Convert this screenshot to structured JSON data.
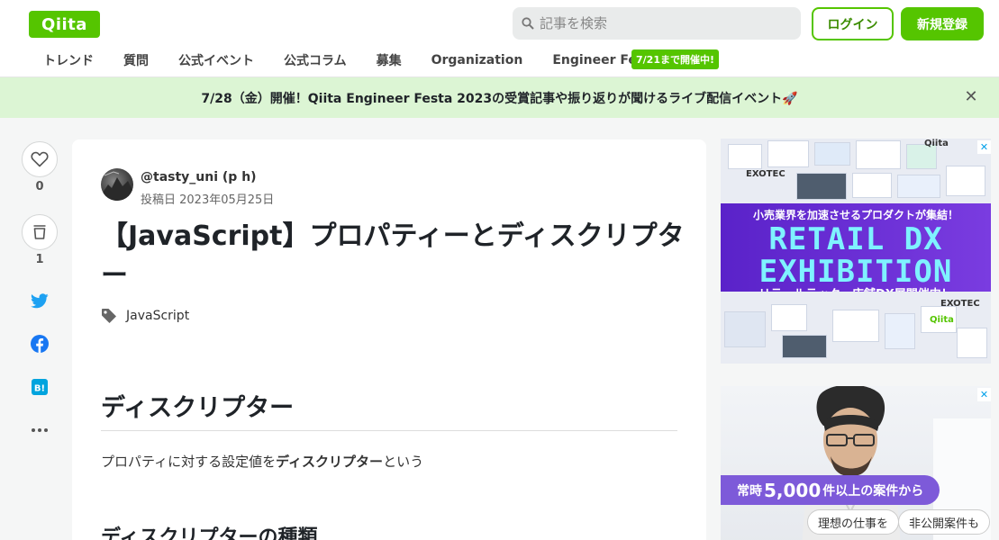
{
  "header": {
    "logo": "Qiita",
    "search_placeholder": "記事を検索",
    "login_label": "ログイン",
    "register_label": "新規登録",
    "nav": [
      "トレンド",
      "質問",
      "公式イベント",
      "公式コラム",
      "募集",
      "Organization",
      "Engineer Festa"
    ],
    "nav_badge": "7/21まで開催中!"
  },
  "banner": {
    "text": "7/28（金）開催！Qiita Engineer Festa 2023の受賞記事や振り返りが聞けるライブ配信イベント🚀",
    "close": "✕"
  },
  "actions": {
    "like_count": "0",
    "stock_count": "1"
  },
  "article": {
    "author": "@tasty_uni (p h)",
    "posted": "投稿日 2023年05月25日",
    "title": "【JavaScript】プロパティーとディスクリプター",
    "tag": "JavaScript",
    "h2": "ディスクリプター",
    "para_prefix": "プロパティに対する設定値を",
    "para_bold": "ディスクリプター",
    "para_suffix": "という",
    "h3": "ディスクリプターの種類"
  },
  "ads": {
    "ad1": {
      "subtitle": "小売業界を加速させるプロダクトが集結！",
      "title_line1": "RETAIL DX",
      "title_line2": "EXHIBITION",
      "footer": "リテールテック・店舗DX展開催中！",
      "brand_exotec": "EXOTEC",
      "brand_qiita": "Qiita"
    },
    "ad2": {
      "pill_prefix": "常時",
      "pill_big": "5,000",
      "pill_suffix": "件以上の案件から",
      "chip1": "理想の仕事を",
      "chip2": "非公開案件も"
    }
  },
  "colors": {
    "brand": "#55c500",
    "banner_bg": "#dcf5d4",
    "twitter": "#1da1f2",
    "facebook": "#1877f2",
    "hatena": "#00a4de"
  }
}
